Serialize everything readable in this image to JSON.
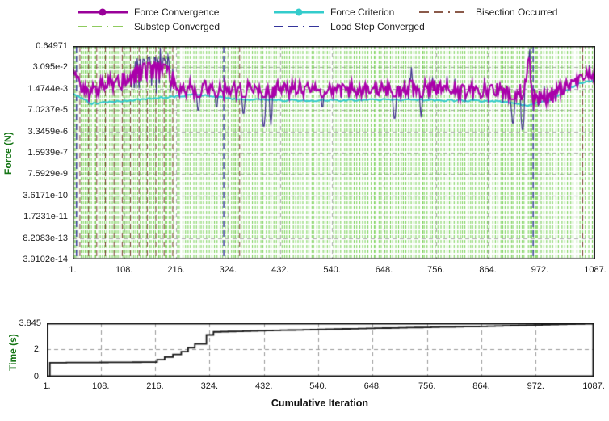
{
  "legend": {
    "items": [
      {
        "label": "Force Convergence",
        "color": "#990099",
        "style": "solid-marker"
      },
      {
        "label": "Force Criterion",
        "color": "#33CCCC",
        "style": "solid-marker"
      },
      {
        "label": "Bisection Occurred",
        "color": "#8B5A4A",
        "style": "dashdot"
      },
      {
        "label": "Substep Converged",
        "color": "#8FCB5E",
        "style": "dashdot"
      },
      {
        "label": "Load Step Converged",
        "color": "#34349B",
        "style": "dashdot"
      }
    ]
  },
  "chart_data": [
    {
      "id": "force-convergence-chart",
      "type": "line",
      "ylabel": "Force (N)",
      "yscale": "log",
      "ytick_labels": [
        "0.64971",
        "3.095e-2",
        "1.4744e-3",
        "7.0237e-5",
        "3.3459e-6",
        "1.5939e-7",
        "7.5929e-9",
        "3.6171e-10",
        "1.7231e-11",
        "8.2083e-13",
        "3.9102e-14"
      ],
      "ytick_logs": [
        -0.18727,
        -1.50934,
        -2.83133,
        -4.1534,
        -5.4755,
        -6.79754,
        -8.11965,
        -9.44164,
        -10.7637,
        -12.08576,
        -13.40782
      ],
      "xticks": [
        1,
        108,
        216,
        324,
        432,
        540,
        648,
        756,
        864,
        972,
        1087
      ],
      "xtick_labels": [
        "1.",
        "108.",
        "216.",
        "324.",
        "432.",
        "540.",
        "648.",
        "756.",
        "864.",
        "972.",
        "1087."
      ],
      "xlim": [
        1,
        1087
      ],
      "grid": true,
      "legend_position": "top",
      "series": [
        {
          "name": "Force Convergence",
          "color": "#AA00AA",
          "spike_color": "#3C2C8C",
          "envelope": [
            [
              1,
              -1.55,
              0.3
            ],
            [
              14,
              -2.5,
              0.5
            ],
            [
              30,
              -3.0,
              0.6
            ],
            [
              55,
              -2.8,
              0.65
            ],
            [
              80,
              -2.55,
              0.8
            ],
            [
              110,
              -2.3,
              1.0
            ],
            [
              130,
              -2.0,
              1.35
            ],
            [
              150,
              -1.75,
              1.65
            ],
            [
              170,
              -1.7,
              1.75
            ],
            [
              195,
              -1.85,
              1.7
            ],
            [
              210,
              -2.3,
              1.2
            ],
            [
              220,
              -2.83,
              0.62
            ],
            [
              400,
              -2.85,
              0.65
            ],
            [
              540,
              -2.85,
              0.58
            ],
            [
              640,
              -2.8,
              0.62
            ],
            [
              760,
              -2.85,
              0.75
            ],
            [
              850,
              -2.9,
              0.85
            ],
            [
              935,
              -3.0,
              0.9
            ],
            [
              950,
              -1.3,
              1.4
            ],
            [
              958,
              -3.35,
              0.85
            ],
            [
              995,
              -3.3,
              0.75
            ],
            [
              1015,
              -2.9,
              0.6
            ],
            [
              1040,
              -2.4,
              0.5
            ],
            [
              1065,
              -2.05,
              0.45
            ],
            [
              1087,
              -1.9,
              0.5
            ]
          ],
          "dips": [
            [
              262,
              -4.5
            ],
            [
              300,
              -4.3
            ],
            [
              356,
              -4.7
            ],
            [
              398,
              -5.5
            ],
            [
              413,
              -5.1
            ],
            [
              520,
              -4.3
            ],
            [
              670,
              -5.0
            ],
            [
              725,
              -4.6
            ],
            [
              916,
              -5.3
            ],
            [
              936,
              -5.7
            ]
          ],
          "spikes": [
            [
              148,
              -0.6
            ],
            [
              160,
              -0.45
            ],
            [
              172,
              -0.5
            ],
            [
              190,
              -0.55
            ],
            [
              200,
              -0.7
            ],
            [
              705,
              -1.5
            ],
            [
              950,
              -0.55
            ],
            [
              1075,
              -1.35
            ]
          ]
        },
        {
          "name": "Force Criterion",
          "color": "#33CCCC",
          "points": [
            [
              1,
              -3.15
            ],
            [
              40,
              -3.75
            ],
            [
              100,
              -3.6
            ],
            [
              160,
              -3.45
            ],
            [
              215,
              -3.3
            ],
            [
              260,
              -3.2
            ],
            [
              330,
              -3.45
            ],
            [
              430,
              -3.55
            ],
            [
              540,
              -3.55
            ],
            [
              640,
              -3.5
            ],
            [
              780,
              -3.55
            ],
            [
              880,
              -3.6
            ],
            [
              945,
              -3.85
            ],
            [
              990,
              -3.6
            ],
            [
              1020,
              -3.05
            ],
            [
              1055,
              -2.5
            ],
            [
              1087,
              -2.35
            ]
          ]
        }
      ],
      "events": {
        "substep_converged": {
          "color": "#6FCE4A",
          "groups": [
            {
              "from": 4,
              "to": 208,
              "step": 4.6
            },
            {
              "from": 212,
              "to": 944,
              "step": 5.6
            },
            {
              "from": 962,
              "to": 1082,
              "step": 6.2
            }
          ],
          "clusters": [
            {
              "center": 957,
              "count": 6,
              "spread": 9
            }
          ]
        },
        "bisection_occurred": {
          "color": "#7A3B2E",
          "positions": [
            16,
            34,
            51,
            69,
            87,
            104,
            121,
            139,
            156,
            174,
            191,
            209,
            348,
            1061
          ]
        },
        "load_step_converged": {
          "color": "#34349B",
          "positions": [
            9,
            315,
            958,
            1087
          ]
        }
      }
    },
    {
      "id": "time-chart",
      "type": "line",
      "ylabel": "Time (s)",
      "xlabel": "Cumulative Iteration",
      "ylim": [
        0,
        3.845
      ],
      "yticks": [
        3.845,
        2,
        0
      ],
      "ytick_labels": [
        "3.845",
        "2.",
        "0."
      ],
      "xticks": [
        1,
        108,
        216,
        324,
        432,
        540,
        648,
        756,
        864,
        972,
        1087
      ],
      "xtick_labels": [
        "1.",
        "108.",
        "216.",
        "324.",
        "432.",
        "540.",
        "648.",
        "756.",
        "864.",
        "972.",
        "1087."
      ],
      "xlim": [
        1,
        1087
      ],
      "grid": true,
      "series": [
        {
          "name": "Time",
          "color": "#161616",
          "render": "step",
          "points": [
            [
              1,
              0
            ],
            [
              7,
              1.0
            ],
            [
              205,
              1.04
            ],
            [
              235,
              1.4
            ],
            [
              268,
              1.8
            ],
            [
              295,
              2.35
            ],
            [
              318,
              3.0
            ],
            [
              332,
              3.22
            ],
            [
              420,
              3.3
            ],
            [
              540,
              3.4
            ],
            [
              700,
              3.52
            ],
            [
              860,
              3.62
            ],
            [
              1000,
              3.75
            ],
            [
              1050,
              3.8
            ],
            [
              1087,
              3.845
            ]
          ]
        }
      ]
    }
  ]
}
